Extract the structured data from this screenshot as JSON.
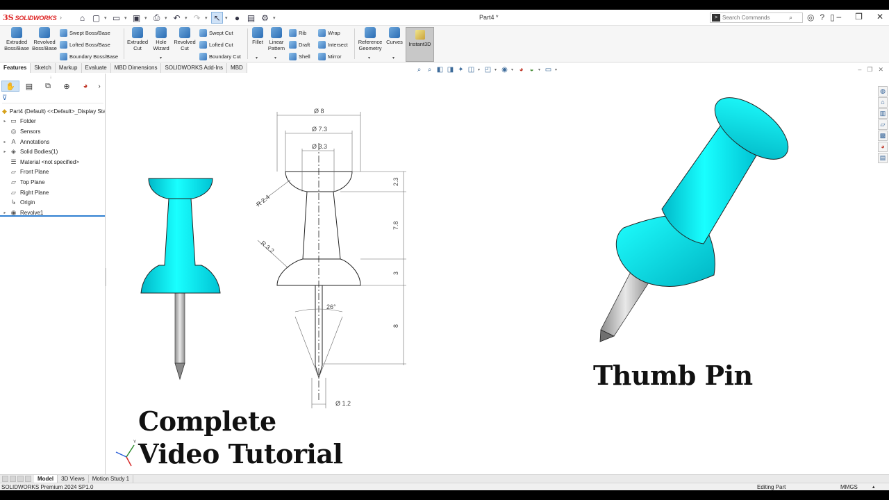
{
  "titlebar": {
    "brand": "SOLIDWORKS",
    "brand_mark": "3S",
    "document_title": "Part4 *",
    "search_placeholder": "Search Commands"
  },
  "ribbon": {
    "extruded_boss": "Extruded Boss/Base",
    "revolved_boss": "Revolved Boss/Base",
    "swept_boss": "Swept Boss/Base",
    "lofted_boss": "Lofted Boss/Base",
    "boundary_boss": "Boundary Boss/Base",
    "extruded_cut": "Extruded Cut",
    "hole_wizard": "Hole Wizard",
    "revolved_cut": "Revolved Cut",
    "swept_cut": "Swept Cut",
    "lofted_cut": "Lofted Cut",
    "boundary_cut": "Boundary Cut",
    "fillet": "Fillet",
    "linear_pattern": "Linear Pattern",
    "rib": "Rib",
    "draft": "Draft",
    "shell": "Shell",
    "wrap": "Wrap",
    "intersect": "Intersect",
    "mirror": "Mirror",
    "reference_geometry": "Reference Geometry",
    "curves": "Curves",
    "instant3d": "Instant3D"
  },
  "tabs": [
    "Features",
    "Sketch",
    "Markup",
    "Evaluate",
    "MBD Dimensions",
    "SOLIDWORKS Add-Ins",
    "MBD"
  ],
  "tree": {
    "root": "Part4 (Default) <<Default>_Display Sta",
    "items": [
      "Folder",
      "Sensors",
      "Annotations",
      "Solid Bodies(1)",
      "Material <not specified>",
      "Front Plane",
      "Top Plane",
      "Right Plane",
      "Origin",
      "Revolve1"
    ]
  },
  "canvas": {
    "title": "Thumb Pin",
    "caption_line1": "Complete",
    "caption_line2": "Video Tutorial",
    "drawing": {
      "dim_top": "Ø 8",
      "dim_mid": "Ø 7.3",
      "dim_inner": "Ø 3.3",
      "radius_top": "R 2.4",
      "radius_bottom": "R 3.2",
      "len_1": "2.3",
      "len_2": "7.8",
      "len_3": "3",
      "len_4": "8",
      "angle": "26°",
      "dim_pin": "Ø 1.2"
    },
    "accent_color": "#00e5e5"
  },
  "bottom_tabs": [
    "Model",
    "3D Views",
    "Motion Study 1"
  ],
  "status": {
    "product": "SOLIDWORKS Premium 2024 SP1.0",
    "mode": "Editing Part",
    "units": "MMGS"
  }
}
